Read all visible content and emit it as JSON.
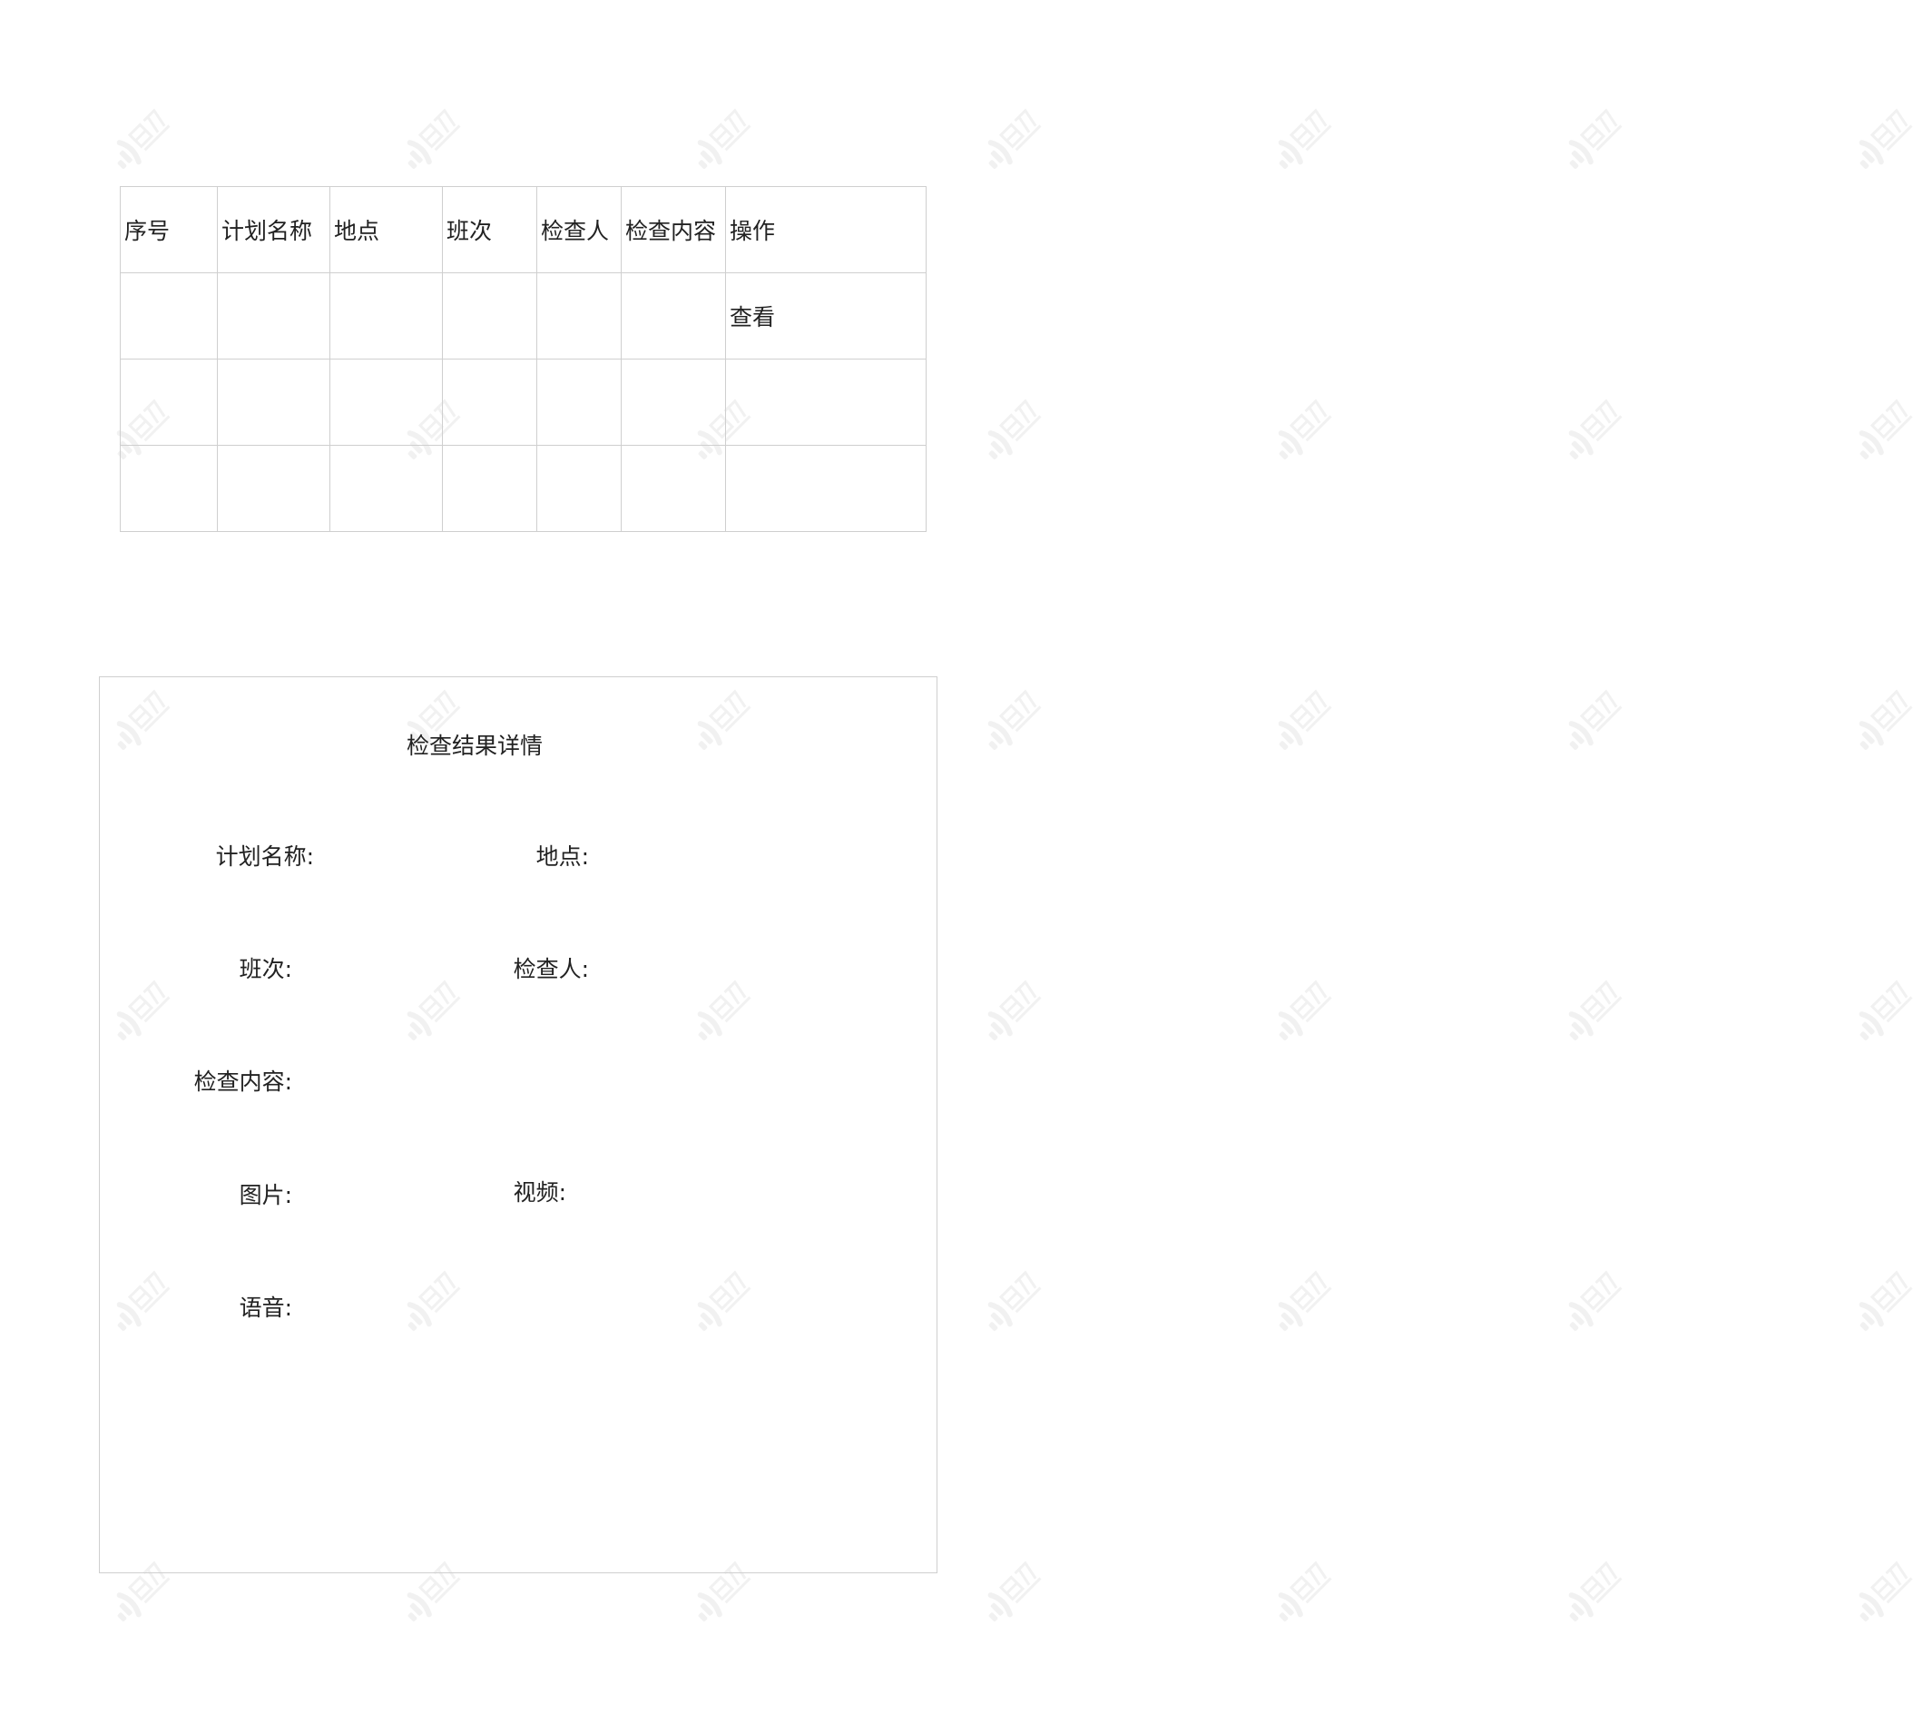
{
  "plan_table": {
    "headers": [
      "序号",
      "计划名称",
      "地点",
      "班次",
      "检查人",
      "检查内容",
      "操作"
    ],
    "rows": [
      [
        "",
        "",
        "",
        "",
        "",
        "",
        "查看"
      ],
      [
        "",
        "",
        "",
        "",
        "",
        "",
        ""
      ],
      [
        "",
        "",
        "",
        "",
        "",
        "",
        ""
      ]
    ]
  },
  "detail": {
    "title": "检查结果详情",
    "labels": {
      "plan_name": "计划名称:",
      "location": "地点:",
      "shift": "班次:",
      "inspector": "检查人:",
      "content": "检查内容:",
      "picture": "图片:",
      "video": "视频:",
      "audio": "语音:"
    }
  },
  "watermark": {
    "icon": "brand-watermark-icon",
    "color": "#e2e2e2"
  }
}
